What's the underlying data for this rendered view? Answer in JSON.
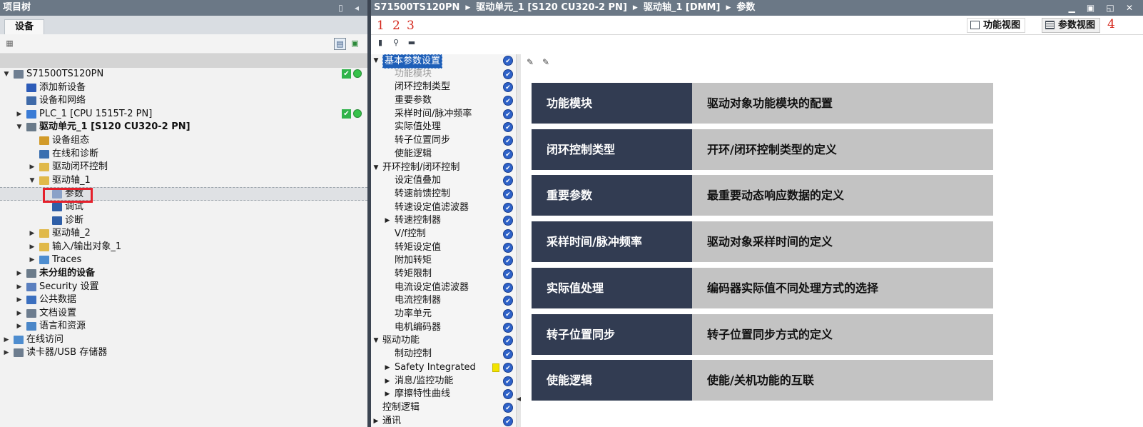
{
  "left_panel": {
    "title": "项目树",
    "tab": "设备",
    "tree": [
      {
        "label": "S71500TS120PN",
        "level": 0,
        "toggle": "down",
        "icon": "project-icon",
        "color": "#6f7f92",
        "status": true
      },
      {
        "label": "添加新设备",
        "level": 1,
        "toggle": "",
        "icon": "add-device-icon",
        "color": "#2c5bb8"
      },
      {
        "label": "设备和网络",
        "level": 1,
        "toggle": "",
        "icon": "network-icon",
        "color": "#3f6aa8"
      },
      {
        "label": "PLC_1 [CPU 1515T-2 PN]",
        "level": 1,
        "toggle": "right",
        "icon": "plc-icon",
        "color": "#3a7bd5",
        "status": true
      },
      {
        "label": "驱动单元_1 [S120 CU320-2 PN]",
        "level": 1,
        "toggle": "down",
        "icon": "drive-unit-icon",
        "color": "#6b7b8a",
        "bold": true
      },
      {
        "label": "设备组态",
        "level": 2,
        "toggle": "",
        "icon": "device-config-icon",
        "color": "#d29b2a"
      },
      {
        "label": "在线和诊断",
        "level": 2,
        "toggle": "",
        "icon": "online-diag-icon",
        "color": "#3a6fb0"
      },
      {
        "label": "驱动闭环控制",
        "level": 2,
        "toggle": "right",
        "icon": "folder-icon",
        "color": "#e0b94a"
      },
      {
        "label": "驱动轴_1",
        "level": 2,
        "toggle": "down",
        "icon": "folder-icon",
        "color": "#e0b94a"
      },
      {
        "label": "参数",
        "level": 3,
        "toggle": "",
        "icon": "parameter-icon",
        "color": "#8aa2c8",
        "selected": true
      },
      {
        "label": "调试",
        "level": 3,
        "toggle": "",
        "icon": "commissioning-icon",
        "color": "#2f5fa8"
      },
      {
        "label": "诊断",
        "level": 3,
        "toggle": "",
        "icon": "diagnostics-icon",
        "color": "#2f5fa8"
      },
      {
        "label": "驱动轴_2",
        "level": 2,
        "toggle": "right",
        "icon": "folder-icon",
        "color": "#e0b94a"
      },
      {
        "label": "输入/输出对象_1",
        "level": 2,
        "toggle": "right",
        "icon": "folder-icon",
        "color": "#e0b94a"
      },
      {
        "label": "Traces",
        "level": 2,
        "toggle": "right",
        "icon": "traces-icon",
        "color": "#4e8dcf"
      },
      {
        "label": "未分组的设备",
        "level": 1,
        "toggle": "right",
        "icon": "ungrouped-icon",
        "color": "#6b7b8a",
        "bold": true
      },
      {
        "label": "Security 设置",
        "level": 1,
        "toggle": "right",
        "icon": "security-icon",
        "color": "#5a7fbf"
      },
      {
        "label": "公共数据",
        "level": 1,
        "toggle": "right",
        "icon": "common-data-icon",
        "color": "#3b6fbf"
      },
      {
        "label": "文档设置",
        "level": 1,
        "toggle": "right",
        "icon": "document-icon",
        "color": "#6d7d8f"
      },
      {
        "label": "语言和资源",
        "level": 1,
        "toggle": "right",
        "icon": "language-icon",
        "color": "#4a86c8"
      },
      {
        "label": "在线访问",
        "level": 0,
        "toggle": "right",
        "icon": "online-access-icon",
        "color": "#4e8dcf"
      },
      {
        "label": "读卡器/USB 存储器",
        "level": 0,
        "toggle": "right",
        "icon": "card-reader-icon",
        "color": "#6d7d8f"
      }
    ]
  },
  "right_panel": {
    "breadcrumb": [
      "S71500TS120PN",
      "驱动单元_1 [S120 CU320-2 PN]",
      "驱动轴_1 [DMM]",
      "参数"
    ],
    "markers": [
      "1",
      "2",
      "3",
      "4"
    ],
    "views": {
      "function_view": "功能视图",
      "parameter_view": "参数视图"
    },
    "nav": [
      {
        "label": "基本参数设置",
        "level": 0,
        "toggle": "down",
        "active": true
      },
      {
        "label": "功能模块",
        "level": 1,
        "toggle": "",
        "disabled": true
      },
      {
        "label": "闭环控制类型",
        "level": 1,
        "toggle": ""
      },
      {
        "label": "重要参数",
        "level": 1,
        "toggle": ""
      },
      {
        "label": "采样时间/脉冲频率",
        "level": 1,
        "toggle": ""
      },
      {
        "label": "实际值处理",
        "level": 1,
        "toggle": ""
      },
      {
        "label": "转子位置同步",
        "level": 1,
        "toggle": ""
      },
      {
        "label": "使能逻辑",
        "level": 1,
        "toggle": ""
      },
      {
        "label": "开环控制/闭环控制",
        "level": 0,
        "toggle": "down"
      },
      {
        "label": "设定值叠加",
        "level": 1,
        "toggle": ""
      },
      {
        "label": "转速前馈控制",
        "level": 1,
        "toggle": ""
      },
      {
        "label": "转速设定值滤波器",
        "level": 1,
        "toggle": ""
      },
      {
        "label": "转速控制器",
        "level": 1,
        "toggle": "right"
      },
      {
        "label": "V/f控制",
        "level": 1,
        "toggle": ""
      },
      {
        "label": "转矩设定值",
        "level": 1,
        "toggle": ""
      },
      {
        "label": "附加转矩",
        "level": 1,
        "toggle": ""
      },
      {
        "label": "转矩限制",
        "level": 1,
        "toggle": ""
      },
      {
        "label": "电流设定值滤波器",
        "level": 1,
        "toggle": ""
      },
      {
        "label": "电流控制器",
        "level": 1,
        "toggle": ""
      },
      {
        "label": "功率单元",
        "level": 1,
        "toggle": ""
      },
      {
        "label": "电机编码器",
        "level": 1,
        "toggle": ""
      },
      {
        "label": "驱动功能",
        "level": 0,
        "toggle": "down"
      },
      {
        "label": "制动控制",
        "level": 1,
        "toggle": ""
      },
      {
        "label": "Safety Integrated",
        "level": 1,
        "toggle": "right",
        "warn": true
      },
      {
        "label": "消息/监控功能",
        "level": 1,
        "toggle": "right"
      },
      {
        "label": "摩擦特性曲线",
        "level": 1,
        "toggle": "right"
      },
      {
        "label": "控制逻辑",
        "level": 0,
        "toggle": ""
      },
      {
        "label": "通讯",
        "level": 0,
        "toggle": "right"
      }
    ],
    "functions": [
      {
        "name": "功能模块",
        "desc": "驱动对象功能模块的配置"
      },
      {
        "name": "闭环控制类型",
        "desc": "开环/闭环控制类型的定义"
      },
      {
        "name": "重要参数",
        "desc": "最重要动态响应数据的定义"
      },
      {
        "name": "采样时间/脉冲频率",
        "desc": "驱动对象采样时间的定义"
      },
      {
        "name": "实际值处理",
        "desc": "编码器实际值不同处理方式的选择"
      },
      {
        "name": "转子位置同步",
        "desc": "转子位置同步方式的定义"
      },
      {
        "name": "使能逻辑",
        "desc": "使能/关机功能的互联"
      }
    ]
  }
}
